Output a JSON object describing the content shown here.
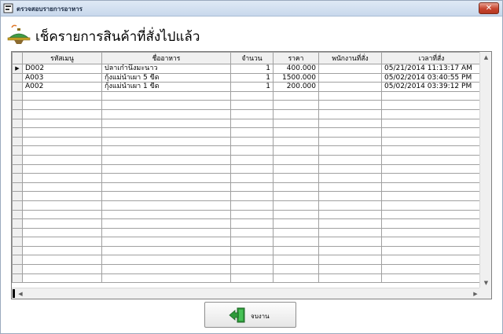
{
  "window": {
    "title": "ตรวจสอบรายการอาหาร",
    "close_label": "✕"
  },
  "header": {
    "title": "เช็ครายการสินค้าที่สั่งไปแล้ว"
  },
  "table": {
    "columns": [
      "รหัสเมนู",
      "ชื่ออาหาร",
      "จำนวน",
      "ราคา",
      "พนักงานที่สั่ง",
      "เวลาที่สั่ง"
    ],
    "rows": [
      {
        "code": "D002",
        "name": "ปลาเก๋านึ่งมะนาว",
        "qty": "1",
        "price": "400.000",
        "staff": "",
        "time": "05/21/2014 11:13:17 AM"
      },
      {
        "code": "A003",
        "name": "กุ้งแม่น้ำเผา 5 ขีด",
        "qty": "1",
        "price": "1500.000",
        "staff": "",
        "time": "05/02/2014 03:40:55 PM"
      },
      {
        "code": "A002",
        "name": "กุ้งแม่น้ำเผา 1 ขีด",
        "qty": "1",
        "price": "200.000",
        "staff": "",
        "time": "05/02/2014 03:39:12 PM"
      }
    ],
    "current_row_marker": "▶"
  },
  "footer": {
    "exit_label": "จบงาน"
  },
  "colors": {
    "grid_border": "#a0a0a0",
    "header_bg": "#f0f0f0",
    "close_red": "#c7452f",
    "exit_icon_green": "#2e9a3a"
  }
}
